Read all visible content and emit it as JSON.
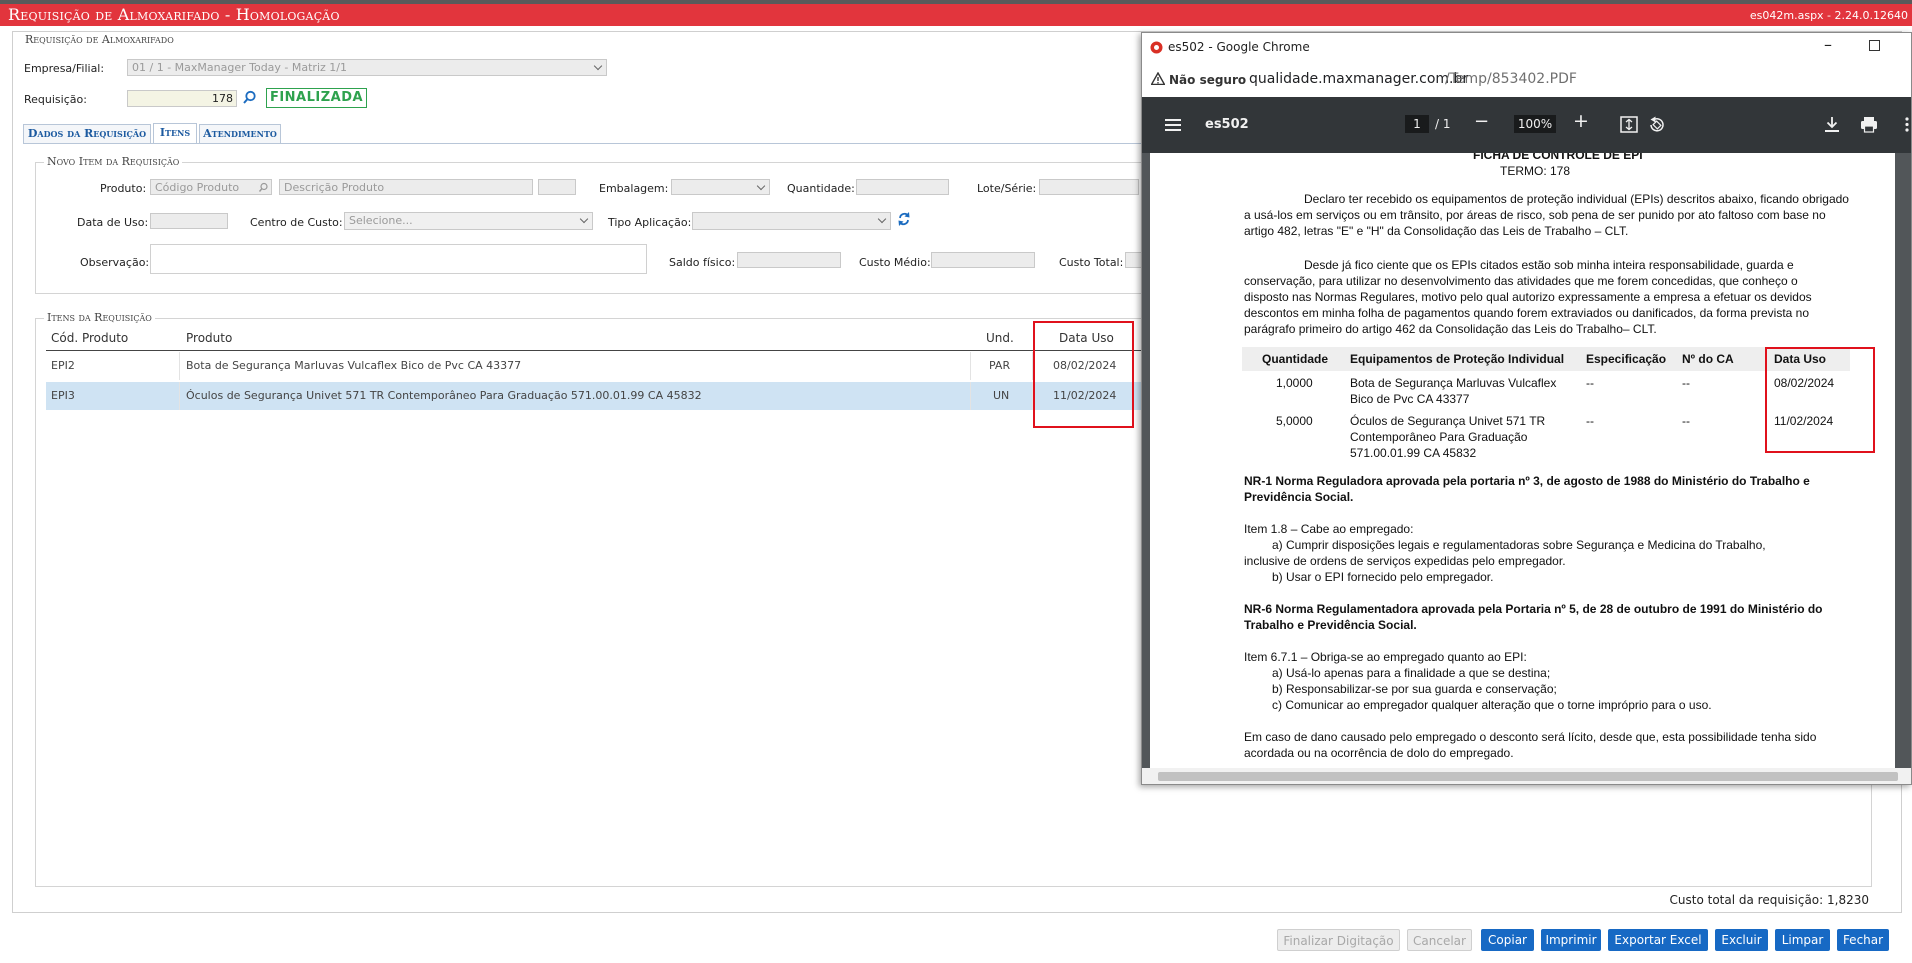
{
  "app": {
    "title": "Requisição de Almoxarifado  - Homologação",
    "version": "es042m.aspx - 2.24.0.12640"
  },
  "form": {
    "section_title": "Requisição de Almoxarifado",
    "empresa_label": "Empresa/Filial:",
    "empresa_value": "01 / 1 - MaxManager Today - Matriz 1/1",
    "requisicao_label": "Requisição:",
    "requisicao_value": "178",
    "status": "FINALIZADA"
  },
  "tabs": [
    {
      "label": "Dados da Requisição"
    },
    {
      "label": "Itens"
    },
    {
      "label": "Atendimento"
    }
  ],
  "novo_item": {
    "title": "Novo Item da Requisição",
    "produto_label": "Produto:",
    "produto_code_placeholder": "Código Produto",
    "produto_desc_placeholder": "Descrição Produto",
    "embalagem_label": "Embalagem:",
    "quantidade_label": "Quantidade:",
    "lote_label": "Lote/Série:",
    "data_uso_label": "Data de Uso:",
    "centro_custo_label": "Centro de Custo:",
    "centro_custo_value": "Selecione...",
    "tipo_aplicacao_label": "Tipo Aplicação:",
    "observacao_label": "Observação:",
    "saldo_label": "Saldo físico:",
    "custo_medio_label": "Custo Médio:",
    "custo_total_label": "Custo Total:"
  },
  "itens": {
    "title": "Itens da Requisição",
    "columns": [
      "Cód. Produto",
      "Produto",
      "Und.",
      "Data Uso"
    ],
    "rows": [
      {
        "code": "EPI2",
        "produto": "Bota de Segurança Marluvas Vulcaflex Bico de Pvc CA 43377",
        "und": "PAR",
        "data": "08/02/2024"
      },
      {
        "code": "EPI3",
        "produto": "Óculos de Segurança Univet 571 TR Contemporâneo Para Graduação 571.00.01.99 CA 45832",
        "und": "UN",
        "data": "11/02/2024"
      }
    ],
    "custo_total": "Custo total da requisição: 1,8230"
  },
  "buttons": {
    "finalizar": "Finalizar Digitação",
    "cancelar": "Cancelar",
    "copiar": "Copiar",
    "imprimir": "Imprimir",
    "exportar": "Exportar Excel",
    "excluir": "Excluir",
    "limpar": "Limpar",
    "fechar": "Fechar"
  },
  "chrome": {
    "window_title": "es502 - Google Chrome",
    "security": "Não seguro",
    "url_host": "qualidade.maxmanager.com.br",
    "url_path": "/Temp/853402.PDF",
    "doc_name": "es502",
    "page_current": "1",
    "page_total": "/  1",
    "zoom": "100%"
  },
  "pdf": {
    "heading": "FICHA DE CONTROLE DE EPI",
    "termo": "TERMO: 178",
    "p1": [
      "Declaro ter recebido os equipamentos de proteção individual (EPIs) descritos abaixo, ficando obrigado",
      "a usá-los em serviços ou em trânsito, por áreas de risco, sob pena de ser punido por ato faltoso com base no",
      "artigo 482, letras \"E\" e \"H\" da Consolidação das Leis de Trabalho – CLT."
    ],
    "p2": [
      "Desde já fico ciente que os EPIs citados estão sob minha inteira responsabilidade, guarda e",
      "conservação, para utilizar no desenvolvimento das atividades que me forem concedidas, que conheço o",
      "disposto nas Normas Regulares, motivo pelo qual autorizo expressamente a empresa a efetuar os devidos",
      "descontos em minha folha de pagamentos quando forem extraviados ou danificados, da forma prevista no",
      "parágrafo primeiro do artigo 462 da Consolidação das Leis do Trabalho– CLT."
    ],
    "table_headers": [
      "Quantidade",
      "Equipamentos de Proteção Individual",
      "Especificação",
      "Nº do CA",
      "Data Uso"
    ],
    "table_rows": [
      {
        "qtd": "1,0000",
        "equip": [
          "Bota de Segurança Marluvas Vulcaflex",
          "Bico de Pvc CA 43377"
        ],
        "spec": "--",
        "ca": "--",
        "data": "08/02/2024"
      },
      {
        "qtd": "5,0000",
        "equip": [
          "Óculos de Segurança Univet 571 TR",
          "Contemporâneo Para Graduação",
          "571.00.01.99 CA 45832"
        ],
        "spec": "--",
        "ca": "--",
        "data": "11/02/2024"
      }
    ],
    "nr1": [
      "NR-1 Norma Reguladora aprovada pela portaria nº 3, de agosto de 1988 do Ministério do Trabalho e",
      "Previdência Social."
    ],
    "item18": [
      "Item 1.8 – Cabe ao empregado:",
      "a) Cumprir disposições legais e regulamentadoras sobre Segurança e Medicina do Trabalho,",
      "inclusive de ordens de serviços expedidas pelo empregador.",
      "b) Usar o EPI fornecido pelo empregador."
    ],
    "nr6": [
      "NR-6 Norma Regulamentadora aprovada pela Portaria nº 5, de 28 de outubro de 1991 do Ministério do",
      "Trabalho e Previdência Social."
    ],
    "item671": [
      "Item 6.7.1 – Obriga-se ao empregado quanto ao EPI:",
      "a) Usá-lo apenas para a finalidade a que se destina;",
      "b) Responsabilizar-se por sua guarda e conservação;",
      "c) Comunicar ao empregador qualquer alteração que o torne impróprio para o uso."
    ],
    "dano": [
      "Em caso de dano causado pelo empregado o desconto será lícito, desde que, esta possibilidade tenha sido",
      "acordada ou na ocorrência de dolo do empregado."
    ]
  }
}
